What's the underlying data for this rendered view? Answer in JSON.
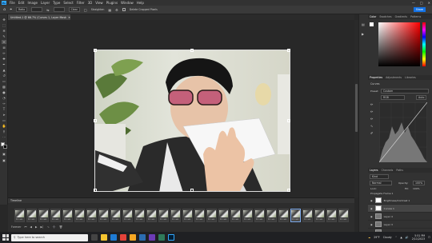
{
  "menubar": {
    "items": [
      "File",
      "Edit",
      "Image",
      "Layer",
      "Type",
      "Select",
      "Filter",
      "3D",
      "View",
      "Plugins",
      "Window",
      "Help"
    ]
  },
  "optionsbar": {
    "style_value": "Auto",
    "mode_value": "Ratio",
    "clear_label": "Clear",
    "straighten_label": "Straighten",
    "delete_cropped_label": "Delete Cropped Pixels",
    "share_label": "Share"
  },
  "document": {
    "tab_title": "Untitled-1 @ 66.7% (Curves 1, Layer Mask/8)"
  },
  "right_panel": {
    "color_tabs": [
      "Color",
      "Swatches",
      "Gradients",
      "Patterns"
    ],
    "props_tabs": [
      "Properties",
      "Adjustments",
      "Libraries"
    ],
    "props_title": "Curves",
    "preset_label": "Preset:",
    "preset_value": "Custom",
    "channel_value": "RGB",
    "auto_label": "Auto",
    "layers_tabs": [
      "Layers",
      "Channels",
      "Paths"
    ],
    "kind_label": "Kind",
    "blend_mode": "Normal",
    "opacity_label": "Opacity:",
    "opacity_value": "100%",
    "lock_label": "Lock:",
    "fill_label": "Fill:",
    "fill_value": "100%",
    "propagate_label": "Propagate Frame 1",
    "layers": [
      {
        "name": "Brightness/Contrast 1"
      },
      {
        "name": "Curves 1"
      },
      {
        "name": "Layer 4"
      },
      {
        "name": "Layer 3"
      },
      {
        "name": "Layer 2"
      },
      {
        "name": "Layer 1"
      }
    ]
  },
  "timeline": {
    "title": "Timeline",
    "frames": [
      {
        "label": "0.1 sec."
      },
      {
        "label": "0.1 sec."
      },
      {
        "label": "0.1 sec."
      },
      {
        "label": "0.1 sec."
      },
      {
        "label": "0.1 sec."
      },
      {
        "label": "0.1 sec."
      },
      {
        "label": "0.1 sec."
      },
      {
        "label": "0.1 sec."
      },
      {
        "label": "0.1 sec."
      },
      {
        "label": "0.1 sec."
      },
      {
        "label": "0.1 sec."
      },
      {
        "label": "0.1 sec."
      },
      {
        "label": "0.1 sec."
      },
      {
        "label": "0.1 sec."
      },
      {
        "label": "0.1 sec."
      },
      {
        "label": "0.1 sec."
      },
      {
        "label": "0.1 sec."
      },
      {
        "label": "0.1 sec."
      },
      {
        "label": "0.1 sec."
      },
      {
        "label": "0.1 sec."
      },
      {
        "label": "0.1 sec."
      },
      {
        "label": "0.1 sec."
      },
      {
        "label": "0.1 sec."
      },
      {
        "label": "0.1 sec."
      },
      {
        "label": "0.1 sec."
      },
      {
        "label": "0.1 sec."
      },
      {
        "label": "0.1 sec."
      },
      {
        "label": "0.1 sec."
      }
    ],
    "loop_value": "Forever"
  },
  "taskbar": {
    "search_placeholder": "Type here to search",
    "weather_temp": "29°F",
    "weather_text": "Cloudy",
    "time": "5:51 PM",
    "date": "2/11/2023"
  },
  "colors": {
    "ps_blue": "#31a8ff",
    "panel_bg": "#323232",
    "accent": "#1473e6"
  }
}
